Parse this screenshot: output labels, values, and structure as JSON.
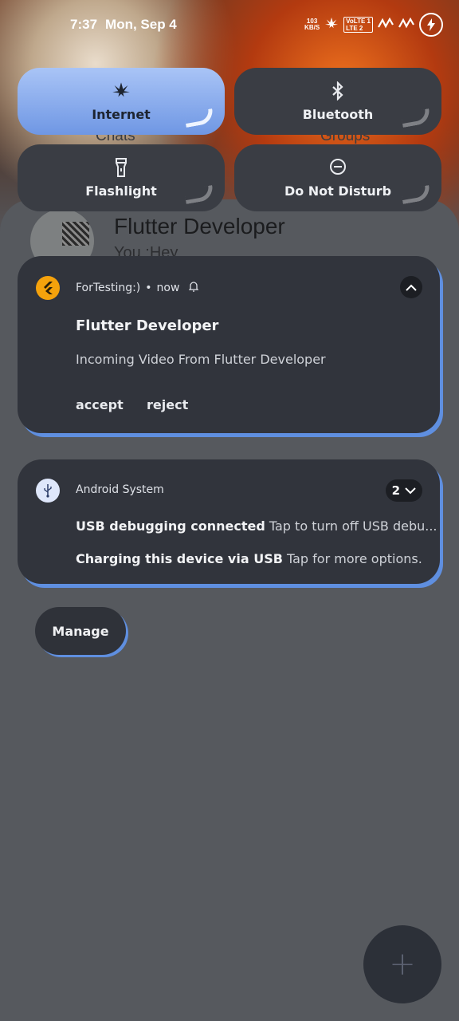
{
  "status_bar": {
    "time": "7:37",
    "date": "Mon, Sep 4",
    "net_speed_value": "103",
    "net_speed_unit": "KB/S",
    "lte_label_top": "VoLTE 1",
    "lte_label_bottom": "LTE 2",
    "battery_icon": "charging-bolt-icon"
  },
  "quick_tiles": [
    {
      "label": "Internet",
      "icon": "leaf-icon",
      "active": true
    },
    {
      "label": "Bluetooth",
      "icon": "bluetooth-icon",
      "active": false
    },
    {
      "label": "Flashlight",
      "icon": "flashlight-icon",
      "active": false
    },
    {
      "label": "Do Not Disturb",
      "icon": "do-not-disturb-icon",
      "active": false
    }
  ],
  "background_app": {
    "tab_left": "Chats",
    "tab_right": "Groups",
    "chat_name": "Flutter Developer",
    "chat_preview": "You :Hey",
    "fab_icon": "+"
  },
  "notifications": [
    {
      "app_name": "ForTesting:)",
      "time": "now",
      "title": "Flutter Developer",
      "body": "Incoming Video From Flutter Developer",
      "actions": [
        "accept",
        "reject"
      ]
    },
    {
      "app_name": "Android System",
      "count": "2",
      "lines": [
        {
          "title": "USB debugging connected",
          "text": "Tap to turn off USB debu..."
        },
        {
          "title": "Charging this device via USB",
          "text": "Tap for more options."
        }
      ]
    }
  ],
  "manage_label": "Manage",
  "colors": {
    "accent": "#6f97e4",
    "card": "#31343c",
    "shade": "#4b4e53"
  }
}
